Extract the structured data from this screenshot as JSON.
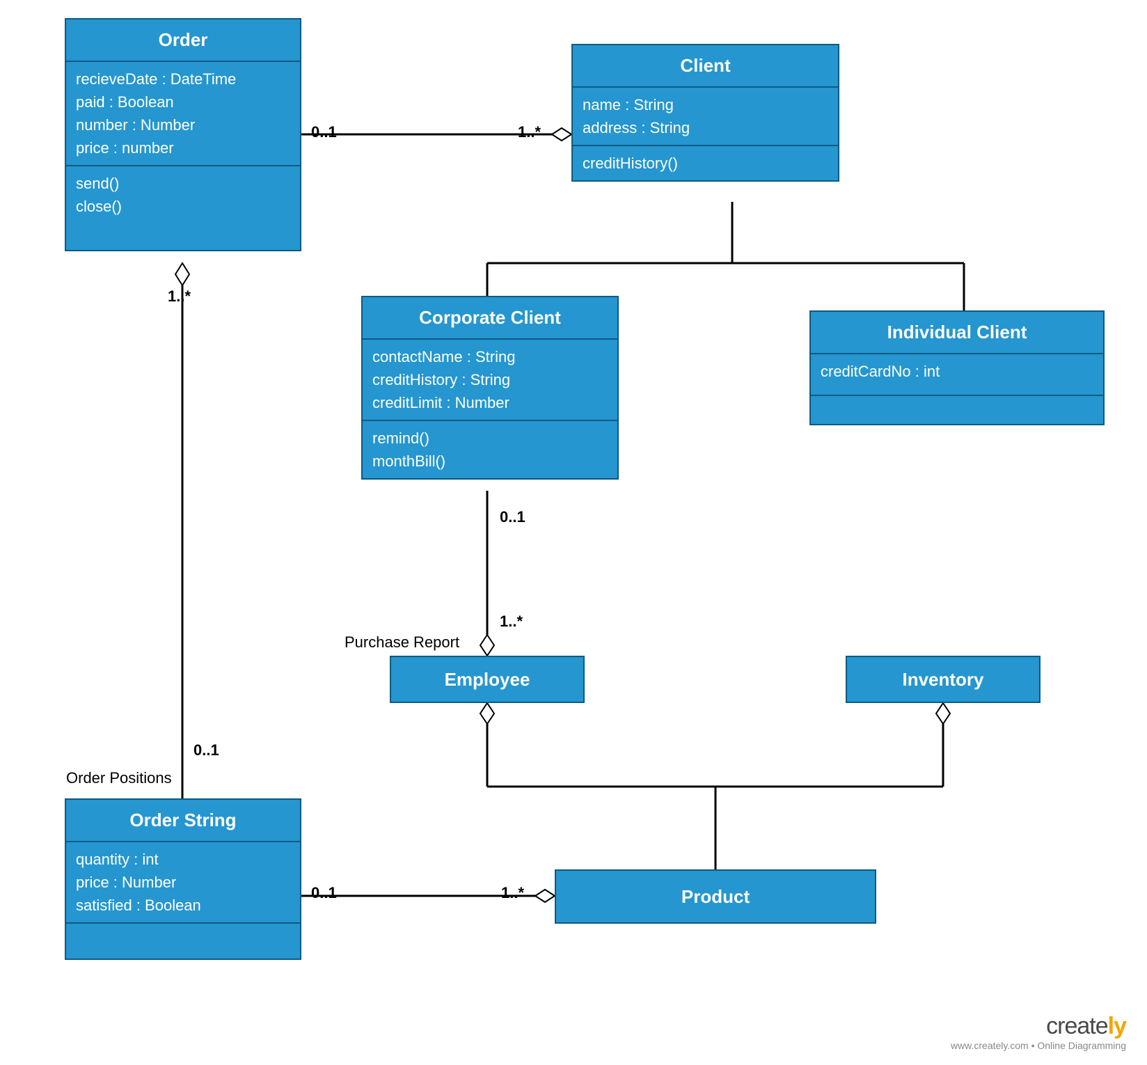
{
  "classes": {
    "order": {
      "title": "Order",
      "attrs": [
        "recieveDate : DateTime",
        "paid : Boolean",
        "number : Number",
        "price : number"
      ],
      "methods": [
        "send()",
        "close()"
      ]
    },
    "client": {
      "title": "Client",
      "attrs": [
        "name  : String",
        "address : String"
      ],
      "methods": [
        "creditHistory()"
      ]
    },
    "corporateClient": {
      "title": "Corporate Client",
      "attrs": [
        "contactName : String",
        "creditHistory : String",
        "creditLimit : Number"
      ],
      "methods": [
        "remind()",
        "monthBill()"
      ]
    },
    "individualClient": {
      "title": "Individual Client",
      "attrs": [
        "creditCardNo : int"
      ],
      "methods": []
    },
    "orderString": {
      "title": "Order String",
      "attrs": [
        "quantity : int",
        "price : Number",
        "satisfied : Boolean"
      ],
      "methods": []
    },
    "employee": {
      "title": "Employee"
    },
    "inventory": {
      "title": "Inventory"
    },
    "product": {
      "title": "Product"
    }
  },
  "multiplicities": {
    "orderToClient_left": "0..1",
    "orderToClient_right": "1..*",
    "orderAgg_bottom": "1..*",
    "orderStringTop": "0..1",
    "corpToEmp_top": "0..1",
    "corpToEmp_bottom": "1..*",
    "orderStringToProduct_left": "0..1",
    "orderStringToProduct_right": "1..*"
  },
  "labels": {
    "purchaseReport": "Purchase Report",
    "orderPositions": "Order Positions"
  },
  "footer": {
    "brand": "create",
    "brandSuffix": "ly",
    "tagline": "www.creately.com • Online Diagramming"
  }
}
